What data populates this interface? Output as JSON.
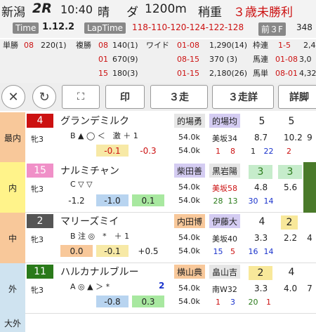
{
  "header": {
    "venue": "新潟",
    "race": "2R",
    "time": "10:40",
    "weather": "晴",
    "surface": "ダ",
    "distance": "1200m",
    "weight_cond": "稍重",
    "class": "３歳未勝利"
  },
  "timebar": {
    "time_label": "Time",
    "time_value": "1.12.2",
    "lap_label": "LapTime",
    "lap_value": "118-110-120-124-122-128",
    "f3_label": "前３F",
    "f3_value": "348"
  },
  "odds": {
    "tansho_label": "単勝",
    "tansho_num": "08",
    "tansho_val": "220(1)",
    "fukusho_label": "複勝",
    "fukusho": [
      [
        "08",
        "140(1)"
      ],
      [
        "01",
        "670(9)"
      ],
      [
        "15",
        "180(3)"
      ]
    ],
    "wide_label": "ワイド",
    "wide": [
      [
        "01-08",
        "1,290(14)"
      ],
      [
        "08-15",
        "370 (3)"
      ],
      [
        "01-15",
        "2,180(26)"
      ]
    ],
    "right_labels": [
      "枠連",
      "馬連",
      "馬単"
    ],
    "right": [
      [
        "1-5",
        "2,4"
      ],
      [
        "01-08",
        "3,0"
      ],
      [
        "08-01",
        "4,32"
      ]
    ]
  },
  "buttons": {
    "close": "✕",
    "refresh": "↻",
    "expand": "⛶",
    "mark": "印",
    "sansou": "３走",
    "sansou_detail": "３走詳",
    "detail": "詳脚"
  },
  "colors": {
    "red": "#cc1111",
    "blue": "#1a33cc",
    "pink": "#f090c8",
    "green": "#2a7a1a",
    "orange_bg": "#f8c89a",
    "purple_bg": "#d4ccf2"
  },
  "rows": [
    {
      "pos": "最内",
      "num": "4",
      "sex": "牝3",
      "name": "グランデミルク",
      "marks": "B ▲ ◯ ＜　激 ＋ 1",
      "v1": "",
      "v2": "-0.1",
      "v3": "-0.3",
      "j1": "的場勇",
      "j2": "的場均",
      "wt": "54.0k",
      "stable": "美坂34",
      "r": [
        "1",
        "8",
        "1",
        "22",
        "2"
      ],
      "n1": "5",
      "n2": "5",
      "o1": "8.7",
      "o2": "10.2",
      "last": "9"
    },
    {
      "pos": "内",
      "num": "15",
      "sex": "牝3",
      "name": "ナルミチャン",
      "marks": "C ▽ ▽",
      "v1": "-1.2",
      "v2": "-1.0",
      "v3": "0.1",
      "j1": "柴田善",
      "j2": "黒岩陽",
      "wt": "54.0k",
      "stable": "美坂58",
      "r": [
        "28",
        "13",
        "30",
        "14"
      ],
      "n1": "3",
      "n2": "3",
      "o1": "4.8",
      "o2": "5.6",
      "last": ""
    },
    {
      "pos": "中",
      "num": "2",
      "sex": "牝3",
      "name": "マリーズミイ",
      "marks": "B 注 ◎　*　＋ 1",
      "v1": "0.0",
      "v2": "-0.1",
      "v3": "+0.5",
      "j1": "内田博",
      "j2": "伊藤大",
      "wt": "54.0k",
      "stable": "美坂40",
      "r": [
        "15",
        "5",
        "16",
        "14"
      ],
      "n1": "4",
      "n2": "2",
      "o1": "3.3",
      "o2": "2.2",
      "last": "4"
    },
    {
      "pos": "外",
      "num": "11",
      "sex": "牝3",
      "name": "ハルカナルブルー",
      "marks": "A ◎ ▲ ＞ *",
      "flag": "2",
      "v1": "",
      "v2": "-0.8",
      "v3": "0.3",
      "j1": "横山典",
      "j2": "畠山吉",
      "wt": "54.0k",
      "stable": "南W32",
      "r": [
        "1",
        "3",
        "20",
        "1"
      ],
      "n1": "2",
      "n2": "4",
      "o1": "3.3",
      "o2": "4.0",
      "last": "7"
    }
  ],
  "footer": {
    "pos": "大外"
  }
}
